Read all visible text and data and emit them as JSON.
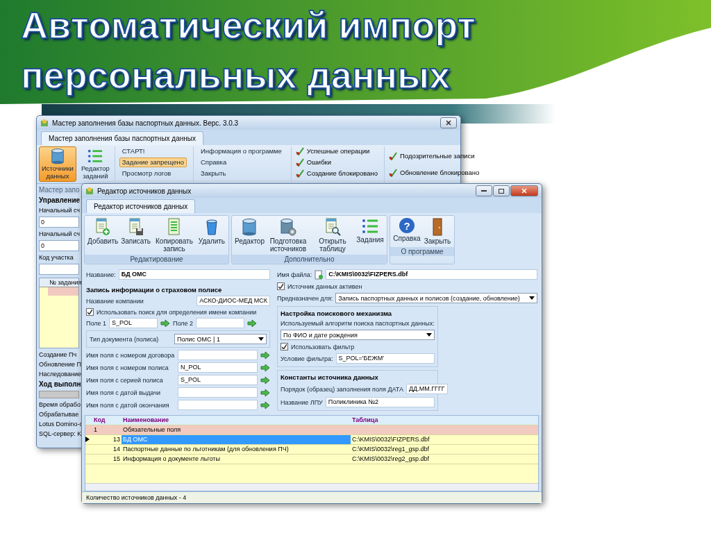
{
  "slide_title": [
    "Автоматический импорт",
    "персональных данных"
  ],
  "back_window": {
    "title": "Мастер заполнения базы паспортных данных. Верс. 3.0.3",
    "tab": "Мастер заполнения базы паспортных данных",
    "big_buttons": [
      {
        "label": "Источники данных",
        "selected": true
      },
      {
        "label": "Редактор заданий",
        "selected": false
      }
    ],
    "task_items": [
      {
        "label": "СТАРТ!",
        "highlighted": false
      },
      {
        "label": "Задание запрещено",
        "highlighted": true
      },
      {
        "label": "Просмотр логов",
        "highlighted": false
      }
    ],
    "info_items": [
      "Информация о программе",
      "Справка",
      "Закрыть"
    ],
    "log_items": [
      "Успешные операции",
      "Ошибки",
      "Создание блокировано"
    ],
    "log_items_2": [
      "Подозрительные записи",
      "Обновление блокировано"
    ],
    "left_panel": [
      {
        "kind": "caption",
        "text": "Мастер запо"
      },
      {
        "kind": "heading",
        "text": "Управление"
      },
      {
        "kind": "label",
        "text": "Начальный сч"
      },
      {
        "kind": "field",
        "text": "0"
      },
      {
        "kind": "label",
        "text": "Начальный сч"
      },
      {
        "kind": "field",
        "text": "0"
      },
      {
        "kind": "label",
        "text": "Код участка"
      },
      {
        "kind": "field"
      },
      {
        "kind": "grid",
        "text": "№ задания"
      },
      {
        "kind": "label",
        "text": "Создание Пч"
      },
      {
        "kind": "label",
        "text": "Обновление П"
      },
      {
        "kind": "label",
        "text": "Наследование"
      },
      {
        "kind": "heading",
        "text": "Ход выполн"
      },
      {
        "kind": "progress",
        "level": 0
      },
      {
        "kind": "label",
        "text": "Время обрабо"
      },
      {
        "kind": "label",
        "text": "Обрабатывае"
      },
      {
        "kind": "label",
        "text": "Lotus Domino-c"
      },
      {
        "kind": "label",
        "text": "SQL-сервер: K"
      }
    ]
  },
  "front_window": {
    "title": "Редактор источников данных",
    "tab": "Редактор источников данных",
    "ribbon_groups": [
      {
        "label": "Редактирование",
        "buttons": [
          {
            "label": "Добавить"
          },
          {
            "label": "Записать"
          },
          {
            "label": "Копировать запись"
          },
          {
            "label": "Удалить"
          }
        ]
      },
      {
        "label": "Дополнительно",
        "buttons": [
          {
            "label": "Редактор"
          },
          {
            "label": "Подготовка источников"
          },
          {
            "label": "Открыть таблицу"
          },
          {
            "label": "Задания"
          }
        ]
      },
      {
        "label": "О программе",
        "buttons": [
          {
            "label": "Справка",
            "glyph": "?"
          },
          {
            "label": "Закрыть"
          }
        ]
      }
    ],
    "form": {
      "name": {
        "label": "Название:",
        "value": "БД ОМС"
      },
      "file": {
        "label": "Имя файла:",
        "value": "C:\\KMIS\\0032\\FIZPERS.dbf"
      },
      "active": {
        "label": "Источник данных активен",
        "checked": true
      },
      "purpose": {
        "label": "Предназначен для:",
        "value": "Запись паспортных данных и полисов (создание, обновление)"
      },
      "policy": {
        "heading": "Запись информации о страховом полисе",
        "company": {
          "label": "Название компании",
          "value": "АСКО-ДИОС-МЕД МСК"
        },
        "use_search": {
          "label": "Использовать поиск для определения имени компании",
          "checked": true
        },
        "field1": {
          "label": "Поле 1",
          "value": "S_POL"
        },
        "field2": {
          "label": "Поле 2"
        },
        "doc_type": {
          "label": "Тип документа (полиса)",
          "value": "Полис ОМС | 1"
        },
        "fields": [
          {
            "label": "Имя поля с номером договора"
          },
          {
            "label": "Имя поля с номером полиса",
            "value": "N_POL"
          },
          {
            "label": "Имя поля с серией полиса",
            "value": "S_POL"
          },
          {
            "label": "Имя поля с датой выдачи"
          },
          {
            "label": "Имя поля с датой окончания"
          }
        ]
      },
      "search": {
        "heading": "Настройка поискового механизма",
        "algorithm": {
          "label": "Используемый алгоритм поиска паспортных данных:",
          "value": "По ФИО и дате рождения"
        },
        "use_filter": {
          "label": "Использовать фильтр",
          "checked": true
        },
        "filter": {
          "label": "Условие фильтра:",
          "value": "S_POL='БЕЖМ'"
        }
      },
      "constants": {
        "heading": "Константы источника данных",
        "rows": [
          {
            "label": "Порядок (образец) заполнения поля ДАТА",
            "value": "ДД.ММ.ГГГГ"
          },
          {
            "label": "Название ЛПУ",
            "value": "Поликлиника №2"
          }
        ]
      }
    },
    "table": {
      "columns": [
        "Код",
        "Наименование",
        "Таблица"
      ],
      "group": {
        "code": "1",
        "name": "Обязательные поля"
      },
      "rows": [
        {
          "code": "13",
          "name": "БД ОМС",
          "table": "C:\\KMIS\\0032\\FIZPERS.dbf",
          "selected": true
        },
        {
          "code": "14",
          "name": "Паспортные данные по льготникам (для обновления ПЧ)",
          "table": "C:\\KMIS\\0032\\reg1_gsp.dbf",
          "selected": false
        },
        {
          "code": "15",
          "name": "Информация о документе льготы",
          "table": "C:\\KMIS\\0032\\reg2_gsp.dbf",
          "selected": false
        }
      ]
    },
    "status_bar": "Количество источников данных - 4"
  }
}
